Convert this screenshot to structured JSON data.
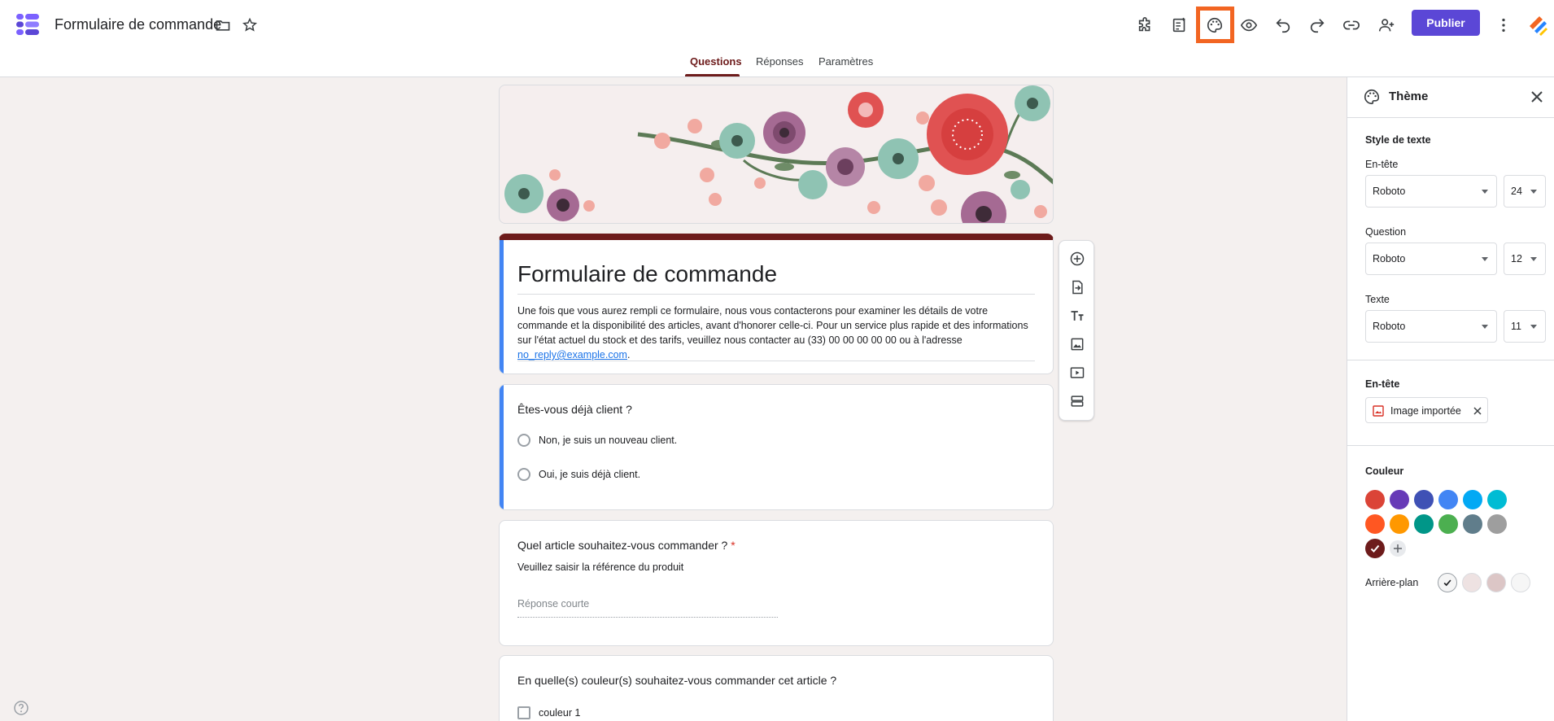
{
  "header": {
    "title": "Formulaire de commande",
    "publish_label": "Publier"
  },
  "tabs": [
    {
      "label": "Questions",
      "active": true
    },
    {
      "label": "Réponses",
      "active": false
    },
    {
      "label": "Paramètres",
      "active": false
    }
  ],
  "form": {
    "title": "Formulaire de commande",
    "description_text": "Une fois que vous aurez rempli ce formulaire, nous vous contacterons pour examiner les détails de votre commande et la disponibilité des articles, avant d'honorer celle-ci. Pour un service plus rapide et des informations sur l'état actuel du stock et des tarifs, veuillez nous contacter au (33) 00 00 00 00 00 ou à l'adresse ",
    "description_link": "no_reply@example.com",
    "description_end": "."
  },
  "questions": [
    {
      "title": "Êtes-vous déjà client ?",
      "options": [
        "Non, je suis un nouveau client.",
        "Oui, je suis déjà client."
      ]
    },
    {
      "title": "Quel article souhaitez-vous commander ?",
      "required_mark": "*",
      "help": "Veuillez saisir la référence du produit",
      "placeholder": "Réponse courte"
    },
    {
      "title": "En quelle(s) couleur(s) souhaitez-vous commander cet article ?",
      "options": [
        "couleur 1"
      ]
    }
  ],
  "theme_panel": {
    "title": "Thème",
    "text_style_title": "Style de texte",
    "fields": [
      {
        "label": "En-tête",
        "font": "Roboto",
        "size": "24"
      },
      {
        "label": "Question",
        "font": "Roboto",
        "size": "12"
      },
      {
        "label": "Texte",
        "font": "Roboto",
        "size": "11"
      }
    ],
    "header_section_title": "En-tête",
    "header_chip_label": "Image importée",
    "color_title": "Couleur",
    "colors": [
      "#db4437",
      "#673ab7",
      "#3f51b5",
      "#4285f4",
      "#03a9f4",
      "#00bcd4",
      "#ff5722",
      "#ff9800",
      "#009688",
      "#4caf50",
      "#607d8b",
      "#9e9e9e",
      "#6d1b1b"
    ],
    "selected_color": "#6d1b1b",
    "background_label": "Arrière-plan",
    "backgrounds": [
      "#f5f5f5",
      "#eee2e2",
      "#dcc6c6",
      "#f6f6f6"
    ]
  },
  "icons": [
    "folder-icon",
    "star-icon",
    "puzzle-icon",
    "note-icon",
    "palette-icon",
    "eye-icon",
    "undo-icon",
    "redo-icon",
    "link-icon",
    "add-person-icon",
    "more-vert-icon",
    "add-circle-icon",
    "import-icon",
    "title-icon",
    "image-icon",
    "video-icon",
    "section-icon",
    "help-icon",
    "close-icon",
    "check-icon",
    "plus-icon"
  ]
}
